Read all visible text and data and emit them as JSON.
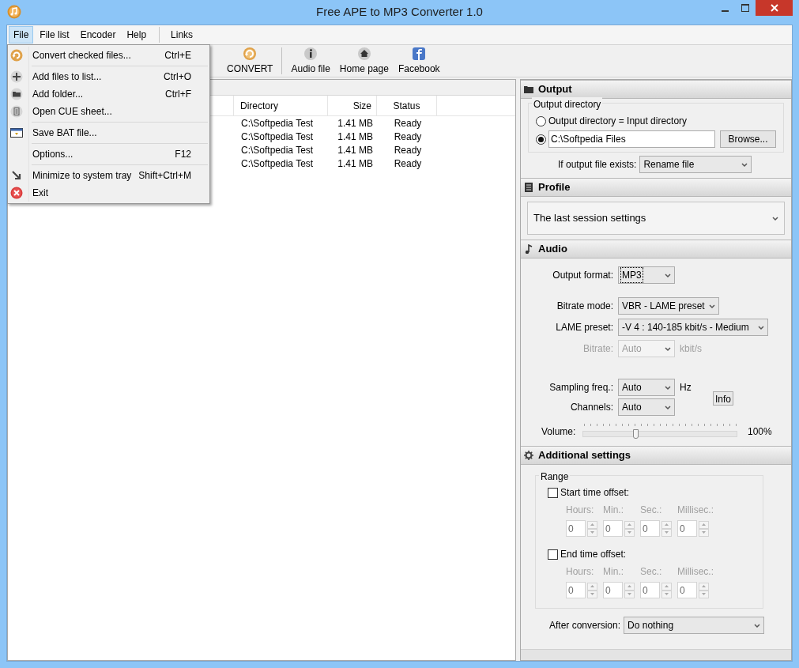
{
  "window": {
    "title": "Free APE to MP3 Converter 1.0"
  },
  "menu_bar": [
    {
      "label": "File",
      "kind": "menu",
      "selected": true
    },
    {
      "label": "File list",
      "kind": "menu",
      "selected": false
    },
    {
      "label": "Encoder",
      "kind": "menu",
      "selected": false
    },
    {
      "label": "Help",
      "kind": "menu",
      "selected": false
    },
    {
      "label": "Links",
      "kind": "link",
      "selected": false
    }
  ],
  "file_menu": [
    {
      "kind": "item",
      "label": "Convert checked files...",
      "shortcut": "Ctrl+E"
    },
    {
      "kind": "separator"
    },
    {
      "kind": "item",
      "label": "Add files to list...",
      "shortcut": "Ctrl+O"
    },
    {
      "kind": "item",
      "label": "Add folder...",
      "shortcut": "Ctrl+F"
    },
    {
      "kind": "item",
      "label": "Open CUE sheet..."
    },
    {
      "kind": "separator"
    },
    {
      "kind": "item",
      "label": "Save BAT file..."
    },
    {
      "kind": "separator"
    },
    {
      "kind": "item",
      "label": "Options...",
      "shortcut": "F12"
    },
    {
      "kind": "separator"
    },
    {
      "kind": "item",
      "label": "Minimize to system tray",
      "shortcut": "Shift+Ctrl+M"
    },
    {
      "kind": "item",
      "label": "Exit"
    }
  ],
  "toolbar": [
    {
      "label": "CONVERT"
    },
    {
      "label": "Audio file"
    },
    {
      "label": "Home page"
    },
    {
      "label": "Facebook"
    }
  ],
  "file_list": {
    "columns": [
      "Directory",
      "Size",
      "Status"
    ],
    "rows": [
      [
        "C:\\Softpedia Test",
        "1.41 MB",
        "Ready"
      ],
      [
        "C:\\Softpedia Test",
        "1.41 MB",
        "Ready"
      ],
      [
        "C:\\Softpedia Test",
        "1.41 MB",
        "Ready"
      ],
      [
        "C:\\Softpedia Test",
        "1.41 MB",
        "Ready"
      ]
    ]
  },
  "output": {
    "title": "Output",
    "group": "Output directory",
    "options": [
      {
        "kind": "label",
        "label": "Output directory = Input directory",
        "selected": false
      },
      {
        "kind": "path",
        "value": "C:\\Softpedia Files",
        "selected": true
      }
    ],
    "browse": "Browse...",
    "exists_label": "If output file exists:",
    "exists_value": "Rename file"
  },
  "profile": {
    "title": "Profile",
    "value": "The last session settings"
  },
  "audio": {
    "title": "Audio",
    "rows": [
      {
        "label": "Output format:",
        "value": "MP3",
        "focused": true,
        "disabled": false
      },
      {
        "label": "Bitrate mode:",
        "value": "VBR - LAME preset",
        "focused": false,
        "disabled": false
      },
      {
        "label": "LAME preset:",
        "value": "-V 4 : 140-185 kbit/s - Medium",
        "focused": false,
        "disabled": false
      },
      {
        "label": "Bitrate:",
        "value": "Auto",
        "unit": "kbit/s",
        "focused": false,
        "disabled": true
      },
      {
        "label": "Sampling freq.:",
        "value": "Auto",
        "unit": "Hz",
        "focused": false,
        "disabled": false
      },
      {
        "label": "Channels:",
        "value": "Auto",
        "focused": false,
        "disabled": false
      }
    ],
    "info": "Info",
    "volume_label": "Volume:",
    "volume": {
      "level": 0.34
    },
    "volume_reading": "100%"
  },
  "additional": {
    "title": "Additional settings",
    "group": "Range",
    "offsets": [
      {
        "label": "Start time offset:",
        "checked": false,
        "fields": [
          {
            "label": "Hours:",
            "value": "0"
          },
          {
            "label": "Min.:",
            "value": "0"
          },
          {
            "label": "Sec.:",
            "value": "0"
          },
          {
            "label": "Millisec.:",
            "value": "0"
          }
        ]
      },
      {
        "label": "End time offset:",
        "checked": false,
        "fields": [
          {
            "label": "Hours:",
            "value": "0"
          },
          {
            "label": "Min.:",
            "value": "0"
          },
          {
            "label": "Sec.:",
            "value": "0"
          },
          {
            "label": "Millisec.:",
            "value": "0"
          }
        ]
      }
    ],
    "after_label": "After conversion:",
    "after_value": "Do nothing"
  }
}
